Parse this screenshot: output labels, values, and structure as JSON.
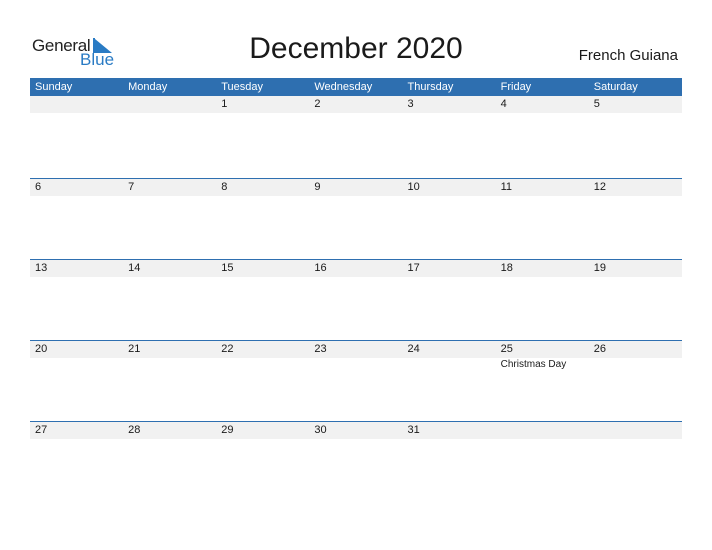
{
  "logo": {
    "line1": "General",
    "line2": "Blue",
    "brand_color": "#2a7bc4"
  },
  "title": "December 2020",
  "country": "French Guiana",
  "header_color": "#2e6fb0",
  "weekdays": [
    "Sunday",
    "Monday",
    "Tuesday",
    "Wednesday",
    "Thursday",
    "Friday",
    "Saturday"
  ],
  "weeks": [
    {
      "days": [
        "",
        "",
        "1",
        "2",
        "3",
        "4",
        "5"
      ],
      "events": [
        "",
        "",
        "",
        "",
        "",
        "",
        ""
      ]
    },
    {
      "days": [
        "6",
        "7",
        "8",
        "9",
        "10",
        "11",
        "12"
      ],
      "events": [
        "",
        "",
        "",
        "",
        "",
        "",
        ""
      ]
    },
    {
      "days": [
        "13",
        "14",
        "15",
        "16",
        "17",
        "18",
        "19"
      ],
      "events": [
        "",
        "",
        "",
        "",
        "",
        "",
        ""
      ]
    },
    {
      "days": [
        "20",
        "21",
        "22",
        "23",
        "24",
        "25",
        "26"
      ],
      "events": [
        "",
        "",
        "",
        "",
        "",
        "Christmas Day",
        ""
      ]
    },
    {
      "days": [
        "27",
        "28",
        "29",
        "30",
        "31",
        "",
        ""
      ],
      "events": [
        "",
        "",
        "",
        "",
        "",
        "",
        ""
      ]
    }
  ]
}
